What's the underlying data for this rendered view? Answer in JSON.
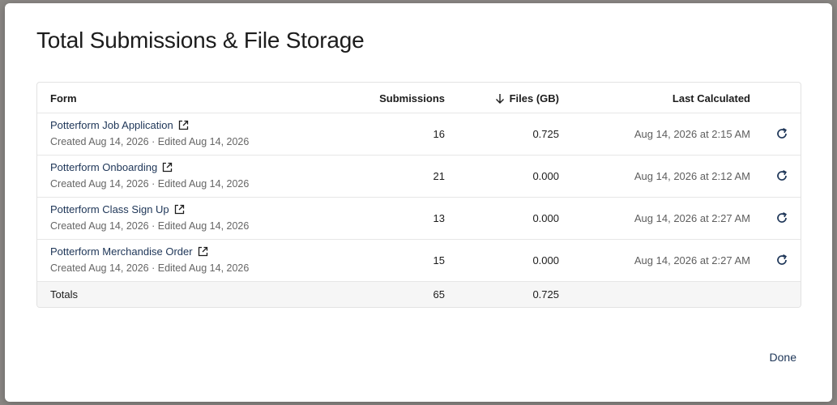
{
  "modal": {
    "title": "Total Submissions & File Storage",
    "done_label": "Done"
  },
  "table": {
    "columns": {
      "form": "Form",
      "submissions": "Submissions",
      "files": "Files (GB)",
      "last_calculated": "Last Calculated"
    },
    "rows": [
      {
        "name": "Potterform Job Application",
        "meta": "Created Aug 14, 2026 · Edited Aug 14, 2026",
        "submissions": "16",
        "files": "0.725",
        "last": "Aug 14, 2026 at 2:15 AM"
      },
      {
        "name": "Potterform Onboarding",
        "meta": "Created Aug 14, 2026 · Edited Aug 14, 2026",
        "submissions": "21",
        "files": "0.000",
        "last": "Aug 14, 2026 at 2:12 AM"
      },
      {
        "name": "Potterform Class Sign Up",
        "meta": "Created Aug 14, 2026 · Edited Aug 14, 2026",
        "submissions": "13",
        "files": "0.000",
        "last": "Aug 14, 2026 at 2:27 AM"
      },
      {
        "name": "Potterform Merchandise Order",
        "meta": "Created Aug 14, 2026 · Edited Aug 14, 2026",
        "submissions": "15",
        "files": "0.000",
        "last": "Aug 14, 2026 at 2:27 AM"
      }
    ],
    "totals": {
      "label": "Totals",
      "submissions": "65",
      "files": "0.725"
    }
  },
  "icons": {
    "sort": "arrow-down-icon",
    "external": "external-link-icon",
    "refresh": "refresh-icon"
  }
}
